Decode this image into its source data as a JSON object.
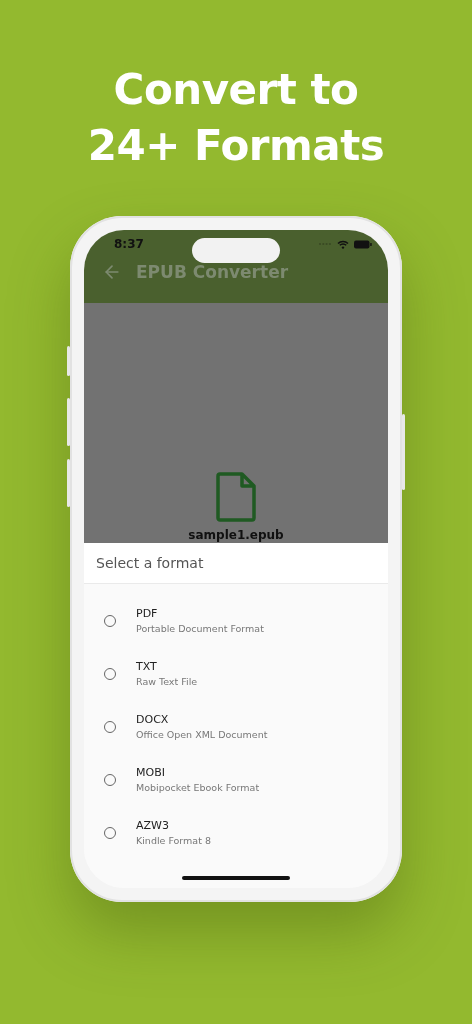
{
  "headline": [
    "Convert to",
    "24+ Formats"
  ],
  "status_bar": {
    "time": "8:37"
  },
  "app_bar": {
    "title": "EPUB Converter"
  },
  "file": {
    "name": "sample1.epub"
  },
  "sheet": {
    "title": "Select a format",
    "options": [
      {
        "label": "PDF",
        "description": "Portable Document Format",
        "selected": false
      },
      {
        "label": "TXT",
        "description": "Raw Text File",
        "selected": false
      },
      {
        "label": "DOCX",
        "description": "Office Open XML Document",
        "selected": false
      },
      {
        "label": "MOBI",
        "description": "Mobipocket Ebook Format",
        "selected": false
      },
      {
        "label": "AZW3",
        "description": "Kindle Format 8",
        "selected": false
      }
    ]
  }
}
